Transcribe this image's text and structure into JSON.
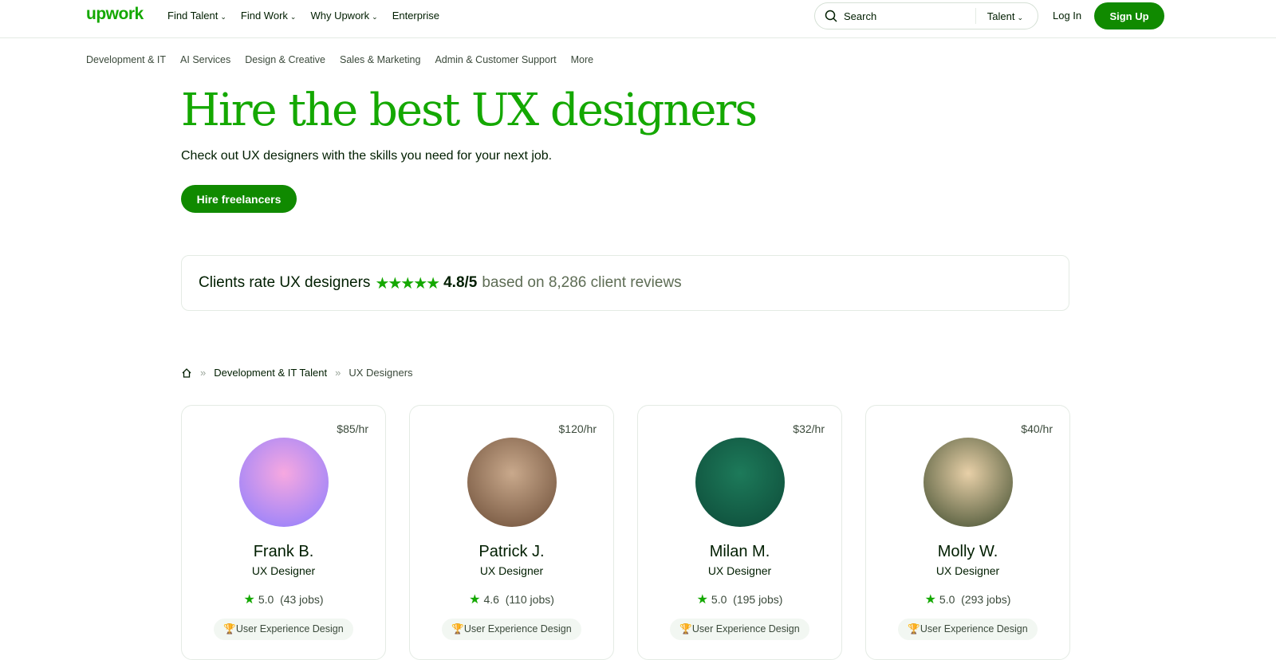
{
  "header": {
    "logo": "upwork",
    "nav": [
      "Find Talent",
      "Find Work",
      "Why Upwork",
      "Enterprise"
    ],
    "search_placeholder": "Search",
    "search_scope": "Talent",
    "login": "Log In",
    "signup": "Sign Up"
  },
  "categories": [
    "Development & IT",
    "AI Services",
    "Design & Creative",
    "Sales & Marketing",
    "Admin & Customer Support",
    "More"
  ],
  "hero": {
    "title": "Hire the best UX designers",
    "subtitle": "Check out UX designers with the skills you need for your next job.",
    "cta": "Hire freelancers"
  },
  "rating": {
    "label": "Clients rate UX designers",
    "stars": "★★★★★",
    "score": "4.8/5",
    "based": "based on 8,286 client reviews"
  },
  "breadcrumb": [
    "Development & IT Talent",
    "UX Designers"
  ],
  "freelancers": [
    {
      "rate": "$85/hr",
      "name": "Frank B.",
      "title": "UX Designer",
      "score": "5.0",
      "jobs": "(43 jobs)",
      "skill": "User Experience Design",
      "avatar_colors": [
        "#f7a8e0",
        "#8a7cff"
      ]
    },
    {
      "rate": "$120/hr",
      "name": "Patrick J.",
      "title": "UX Designer",
      "score": "4.6",
      "jobs": "(110 jobs)",
      "skill": "User Experience Design",
      "avatar_colors": [
        "#c9a98c",
        "#6b4c36"
      ]
    },
    {
      "rate": "$32/hr",
      "name": "Milan M.",
      "title": "UX Designer",
      "score": "5.0",
      "jobs": "(195 jobs)",
      "skill": "User Experience Design",
      "avatar_colors": [
        "#1d7a5a",
        "#0d4a38"
      ]
    },
    {
      "rate": "$40/hr",
      "name": "Molly W.",
      "title": "UX Designer",
      "score": "5.0",
      "jobs": "(293 jobs)",
      "skill": "User Experience Design",
      "avatar_colors": [
        "#e8d0a8",
        "#3c4a2c"
      ]
    }
  ]
}
